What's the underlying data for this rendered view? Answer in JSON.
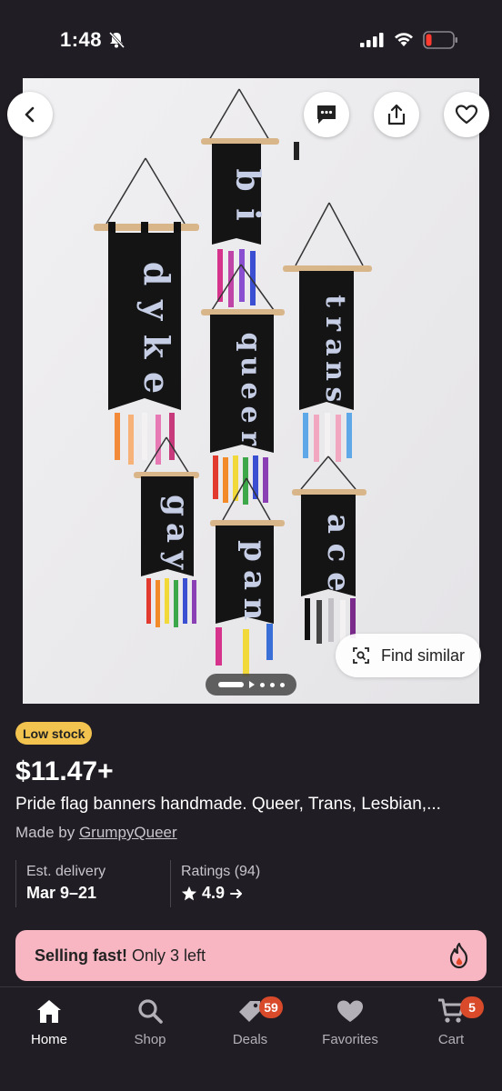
{
  "status": {
    "time": "1:48"
  },
  "product": {
    "stock_badge": "Low stock",
    "price": "$11.47+",
    "title": "Pride flag banners handmade. Queer, Trans, Lesbian,...",
    "made_by_prefix": "Made by ",
    "shop_name": "GrumpyQueer"
  },
  "image": {
    "banners": [
      "dyke",
      "bi",
      "queer",
      "trans",
      "gay",
      "pan",
      "ace"
    ],
    "find_similar_label": "Find similar"
  },
  "info": {
    "delivery_label": "Est. delivery",
    "delivery_value": "Mar 9–21",
    "ratings_label": "Ratings (94)",
    "rating_value": "4.9"
  },
  "selling_fast": {
    "bold": "Selling fast!",
    "rest": "Only 3 left"
  },
  "tabs": [
    {
      "label": "Home",
      "icon": "home-icon"
    },
    {
      "label": "Shop",
      "icon": "search-icon"
    },
    {
      "label": "Deals",
      "icon": "tag-icon",
      "badge": "59"
    },
    {
      "label": "Favorites",
      "icon": "heart-icon"
    },
    {
      "label": "Cart",
      "icon": "cart-icon",
      "badge": "5"
    }
  ],
  "colors": {
    "background": "#211d24",
    "stock_badge": "#f2c44f",
    "selling_fast_bg": "#f8b6c3",
    "badge_red": "#d84a2a"
  }
}
